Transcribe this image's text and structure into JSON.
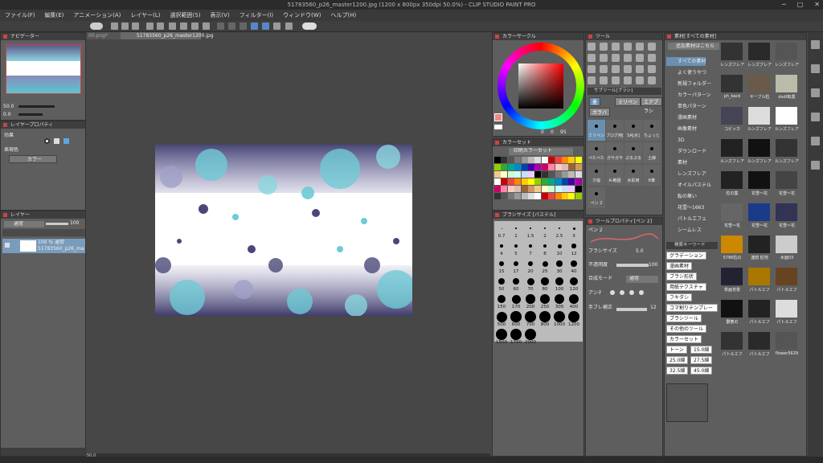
{
  "window": {
    "title": "51783560_p26_master1200.jpg (1200 x 800px 350dpi 50.0%) - CLIP STUDIO PAINT PRO",
    "min": "─",
    "max": "□",
    "close": "✕"
  },
  "menu": [
    "ファイル(F)",
    "編集(E)",
    "アニメーション(A)",
    "レイヤー(L)",
    "選択範囲(S)",
    "表示(V)",
    "フィルター(I)",
    "ウィンドウ(W)",
    "ヘルプ(H)"
  ],
  "navigator": {
    "title": "ナビゲーター",
    "zoom": "50.0",
    "angle": "0.0"
  },
  "layer_property": {
    "title": "レイヤープロパティ",
    "effect": "効果",
    "expression_color": "表現色",
    "color_value": "カラー"
  },
  "layers": {
    "title": "レイヤー",
    "blend_mode": "通常",
    "opacity": "100",
    "layer_opacity_mode": "100 % 通常",
    "layer_name": "51783560_p26_maste"
  },
  "canvas": {
    "doc_tab": "51783560_p26_master1200.jpg",
    "other_tab": "00.png*",
    "zoom_status": "50.0",
    "bottom_left": "50.0"
  },
  "color_circle": {
    "title": "カラーサークル",
    "values": [
      "0",
      "0",
      "95"
    ]
  },
  "color_set": {
    "title": "カラーセット",
    "set_name": "印刷カラーセット"
  },
  "brush_size": {
    "title": "ブラシサイズ",
    "panel_title2": "[パステル]",
    "sizes": [
      "0.7",
      "1",
      "1.5",
      "2",
      "2.5",
      "3",
      "4",
      "5",
      "7",
      "8",
      "10",
      "12",
      "15",
      "17",
      "20",
      "25",
      "30",
      "40",
      "50",
      "60",
      "70",
      "80",
      "100",
      "120",
      "150",
      "170",
      "200",
      "250",
      "300",
      "400",
      "500",
      "600",
      "700",
      "800",
      "1000",
      "1200",
      "1500",
      "1700",
      "2000"
    ]
  },
  "tool": {
    "title": "ツール",
    "sub_title": "サブツール[ブラシ]",
    "tabs": [
      "墨",
      "ミリペン",
      "エアブラシ",
      "厚塗り",
      "レトロ"
    ],
    "tab2": "ガラバ",
    "grid": [
      "ミリペン",
      "ブラシ",
      "デコ",
      "ちょっと太め"
    ]
  },
  "sub_tools": [
    "ミリペン",
    "ブログ用[7]",
    "SA[水]",
    "ちょっと",
    "ぺたぺた",
    "ガサガサ",
    "ぷるぷる",
    "土線",
    "カ塩",
    "A-範囲",
    "水彩用",
    "K筆",
    "ペン 2"
  ],
  "tool_property": {
    "title": "ツールプロパティ[ペン 2]",
    "brush_name": "ペン 2",
    "brush_size_label": "ブラシサイズ",
    "brush_size": "5.0",
    "opacity_label": "不透明度",
    "opacity": "100",
    "blend_label": "合成モード",
    "blend_value": "通常",
    "aa_label": "アンチ",
    "stabilization_label": "手ブレ補正",
    "stabilization": "12"
  },
  "material": {
    "title": "素材[すべての素材]",
    "search_placeholder": "追加素材はこちら",
    "tree": [
      "すべての素材",
      "よく使うやつ",
      "新規フォルダー",
      "カラーパターン",
      "単色パターン",
      "漫画素材",
      "画像素材",
      "3D",
      "ダウンロード",
      "素材",
      "レンズフレア",
      "オイルパステル",
      "転の無い",
      "花雪～1663",
      "パトルエフェ",
      "シームレス"
    ],
    "search_title": "検索キーワード",
    "keywords": [
      "グラデーション",
      "漫画素材",
      "ブラシ形状",
      "用紙テクスチャ",
      "フキダシ",
      "コマ割りテンプレート",
      "ブラシツール",
      "その他のツール",
      "カラーセット",
      "トーン",
      "15.0線",
      "25.0線",
      "27.5線",
      "32.5線",
      "45.0線"
    ],
    "thumb_labels": [
      "レンズフレア",
      "レンズフレア",
      "レンズフレア",
      "ph_back",
      "サーブル粒",
      "dodt転置",
      "コビッカ",
      "ルンズフレア",
      "ルンズフレア",
      "ルンズフレア",
      "ルンズフレア",
      "ルンズフレア",
      "粒の集",
      "花雪～花",
      "花雪～花",
      "花雪～花",
      "花雪～花",
      "花雪～花",
      "5786粒の",
      "連続 粒地",
      "水面03",
      "単画背景",
      "パトルエフ",
      "パトルエフ",
      "鬱蒼の",
      "パトルエフ",
      "パトルエフ",
      "パトルエフ",
      "パトルエフ",
      "flower5629"
    ]
  }
}
